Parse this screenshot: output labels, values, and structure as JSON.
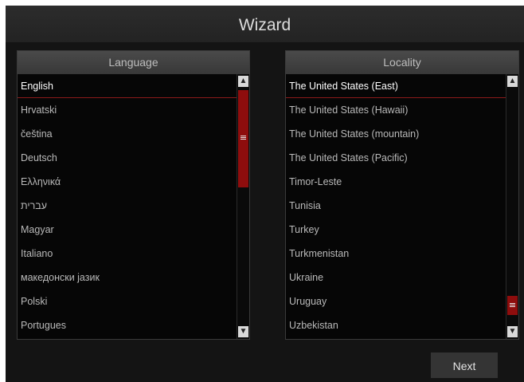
{
  "title": "Wizard",
  "language": {
    "header": "Language",
    "items": [
      "English",
      "Hrvatski",
      "čeština",
      "Deutsch",
      "Ελληνικά",
      "עברית",
      "Magyar",
      "Italiano",
      "македонски јазик",
      "Polski",
      "Portugues"
    ],
    "selected": "English"
  },
  "locality": {
    "header": "Locality",
    "items": [
      "The United States (East)",
      "The United States (Hawaii)",
      "The United States (mountain)",
      "The United States (Pacific)",
      "Timor-Leste",
      "Tunisia",
      "Turkey",
      "Turkmenistan",
      "Ukraine",
      "Uruguay",
      "Uzbekistan"
    ],
    "selected": "The United States (East)"
  },
  "next_label": "Next",
  "colors": {
    "accent": "#8e0d0d",
    "background": "#141414"
  }
}
